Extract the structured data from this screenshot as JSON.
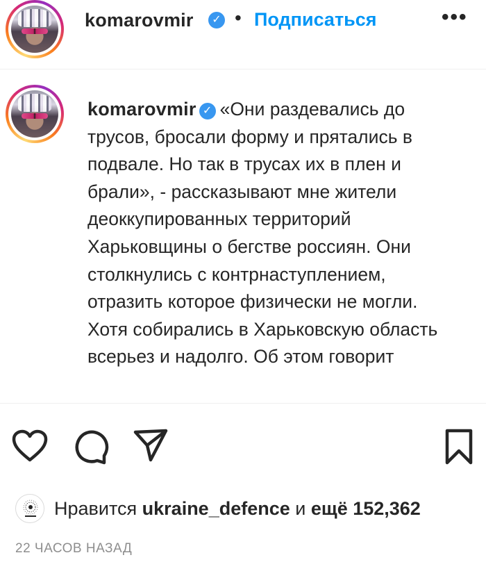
{
  "header": {
    "username": "komarovmir",
    "verified_badge": "verified-badge-icon",
    "separator": "•",
    "follow_label": "Подписаться",
    "more_label": "•••"
  },
  "caption": {
    "username": "komarovmir",
    "text": "«Они раздевались до трусов, бросали форму и прятались в подвале. Но так в трусах их в плен и брали», - рассказывают мне жители деоккупированных территорий Харьковщины о бегстве россиян. Они столкнулись с контрнаступлением, отразить которое физически не могли. Хотя собирались в Харьковскую область всерьез и надолго. Об этом говорит"
  },
  "actions": {
    "like": "heart-icon",
    "comment": "comment-icon",
    "share": "paper-plane-icon",
    "save": "bookmark-icon"
  },
  "likes": {
    "prefix": "Нравится",
    "liker": "ukraine_defence",
    "connector": "и",
    "others": "ещё 152,362"
  },
  "timestamp": "22 ЧАСОВ НАЗАД",
  "colors": {
    "link_blue": "#0095f6",
    "verified_blue": "#3897f0",
    "text": "#262626",
    "muted": "#8e8e8e"
  }
}
